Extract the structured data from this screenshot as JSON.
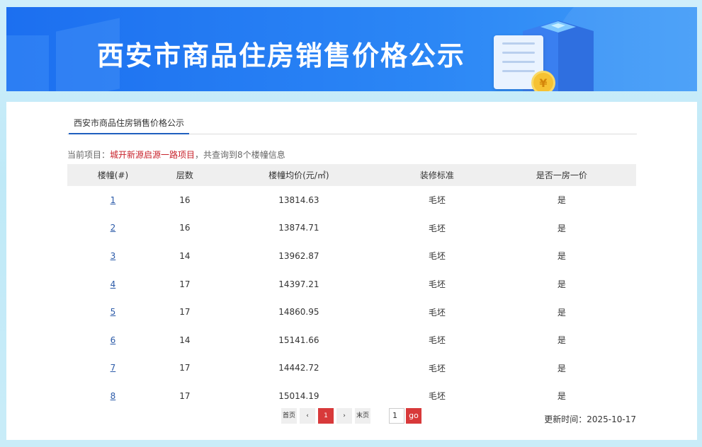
{
  "banner": {
    "title": "西安市商品住房销售价格公示",
    "coin_symbol": "¥"
  },
  "tab": {
    "label": "西安市商品住房销售价格公示"
  },
  "info": {
    "prefix": "当前项目：",
    "project": "城开新源启源一路项目",
    "middle": "，共查询到",
    "count": "8",
    "suffix": "个楼幢信息"
  },
  "table": {
    "headers": [
      "楼幢(#)",
      "层数",
      "楼幢均价(元/㎡)",
      "装修标准",
      "是否一房一价"
    ],
    "rows": [
      [
        "1",
        "16",
        "13814.63",
        "毛坯",
        "是"
      ],
      [
        "2",
        "16",
        "13874.71",
        "毛坯",
        "是"
      ],
      [
        "3",
        "14",
        "13962.87",
        "毛坯",
        "是"
      ],
      [
        "4",
        "17",
        "14397.21",
        "毛坯",
        "是"
      ],
      [
        "5",
        "17",
        "14860.95",
        "毛坯",
        "是"
      ],
      [
        "6",
        "14",
        "15141.66",
        "毛坯",
        "是"
      ],
      [
        "7",
        "17",
        "14442.72",
        "毛坯",
        "是"
      ],
      [
        "8",
        "17",
        "15014.19",
        "毛坯",
        "是"
      ]
    ]
  },
  "pager": {
    "first": "首页",
    "prev": "‹",
    "current": "1",
    "next": "›",
    "last": "末页",
    "input_value": "1",
    "go": "go"
  },
  "update": {
    "label": "更新时间：",
    "date": "2025-10-17"
  },
  "colors": {
    "accent": "#d8393a",
    "link": "#2b5aa8",
    "banner": "#1c6ff0"
  }
}
